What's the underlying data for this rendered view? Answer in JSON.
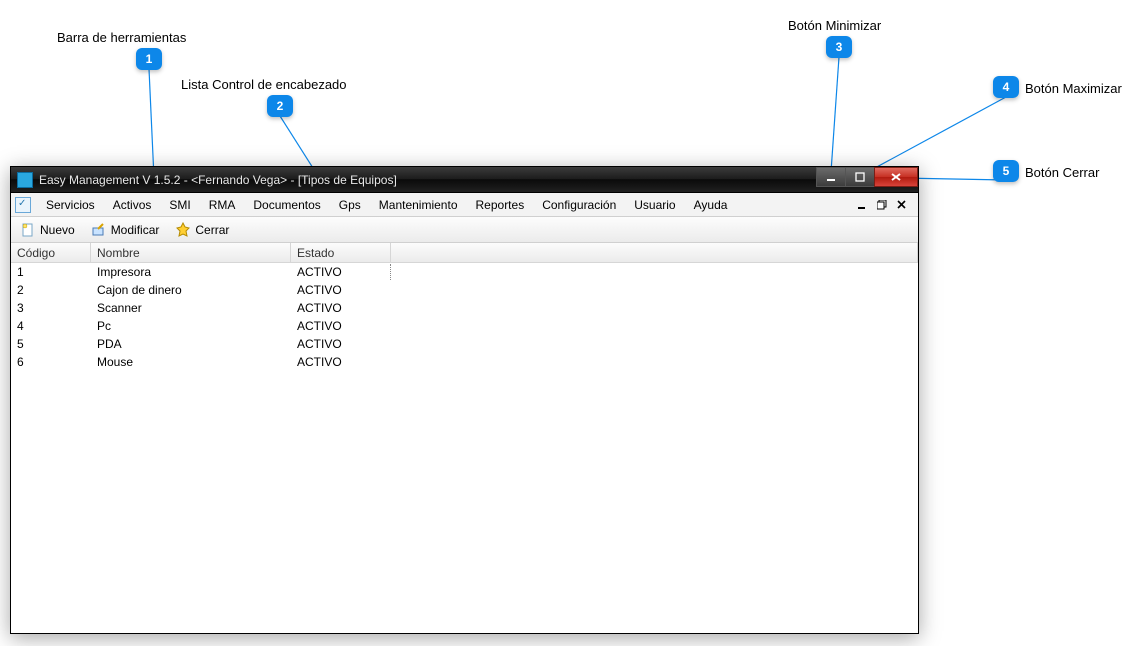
{
  "annotations": {
    "a1": {
      "num": "1",
      "label": "Barra de herramientas"
    },
    "a2": {
      "num": "2",
      "label": "Lista Control de encabezado"
    },
    "a3": {
      "num": "3",
      "label": "Botón Minimizar"
    },
    "a4": {
      "num": "4",
      "label": "Botón Maximizar"
    },
    "a5": {
      "num": "5",
      "label": "Botón Cerrar"
    }
  },
  "window": {
    "title": "Easy Management V 1.5.2 - <Fernando Vega> - [Tipos de Equipos]"
  },
  "menu": {
    "items": [
      "Servicios",
      "Activos",
      "SMI",
      "RMA",
      "Documentos",
      "Gps",
      "Mantenimiento",
      "Reportes",
      "Configuración",
      "Usuario",
      "Ayuda"
    ]
  },
  "toolbar": {
    "nuevo": "Nuevo",
    "modificar": "Modificar",
    "cerrar": "Cerrar"
  },
  "list": {
    "headers": {
      "codigo": "Código",
      "nombre": "Nombre",
      "estado": "Estado"
    },
    "rows": [
      {
        "codigo": "1",
        "nombre": "Impresora",
        "estado": "ACTIVO"
      },
      {
        "codigo": "2",
        "nombre": "Cajon de dinero",
        "estado": "ACTIVO"
      },
      {
        "codigo": "3",
        "nombre": "Scanner",
        "estado": "ACTIVO"
      },
      {
        "codigo": "4",
        "nombre": "Pc",
        "estado": "ACTIVO"
      },
      {
        "codigo": "5",
        "nombre": "PDA",
        "estado": "ACTIVO"
      },
      {
        "codigo": "6",
        "nombre": "Mouse",
        "estado": "ACTIVO"
      }
    ]
  }
}
